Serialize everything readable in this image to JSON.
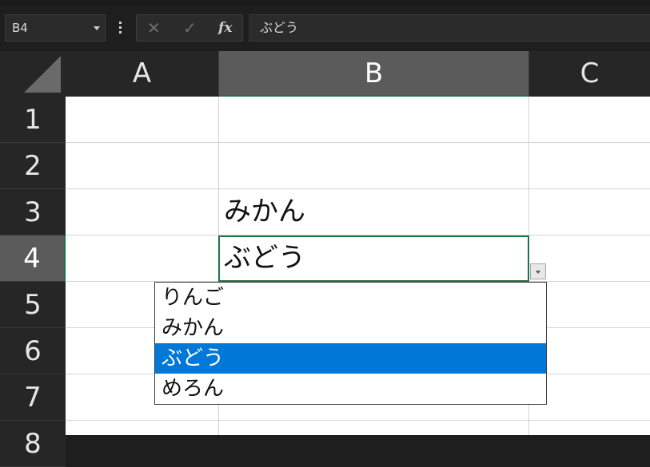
{
  "formula_bar": {
    "name_box": "B4",
    "cancel_symbol": "✕",
    "enter_symbol": "✓",
    "function_symbol": "fx",
    "content": "ぶどう"
  },
  "columns": [
    {
      "label": "A",
      "selected": false
    },
    {
      "label": "B",
      "selected": true
    },
    {
      "label": "C",
      "selected": false
    }
  ],
  "rows": [
    {
      "label": "1",
      "selected": false
    },
    {
      "label": "2",
      "selected": false
    },
    {
      "label": "3",
      "selected": false
    },
    {
      "label": "4",
      "selected": true
    },
    {
      "label": "5",
      "selected": false
    },
    {
      "label": "6",
      "selected": false
    },
    {
      "label": "7",
      "selected": false
    },
    {
      "label": "8",
      "selected": false
    }
  ],
  "cells": {
    "B3": "みかん",
    "B4": "ぶどう"
  },
  "dropdown": {
    "options": [
      "りんご",
      "みかん",
      "ぶどう",
      "めろん"
    ],
    "selected_index": 2
  },
  "colors": {
    "selection_border": "#217346",
    "dropdown_highlight": "#0078d7"
  }
}
